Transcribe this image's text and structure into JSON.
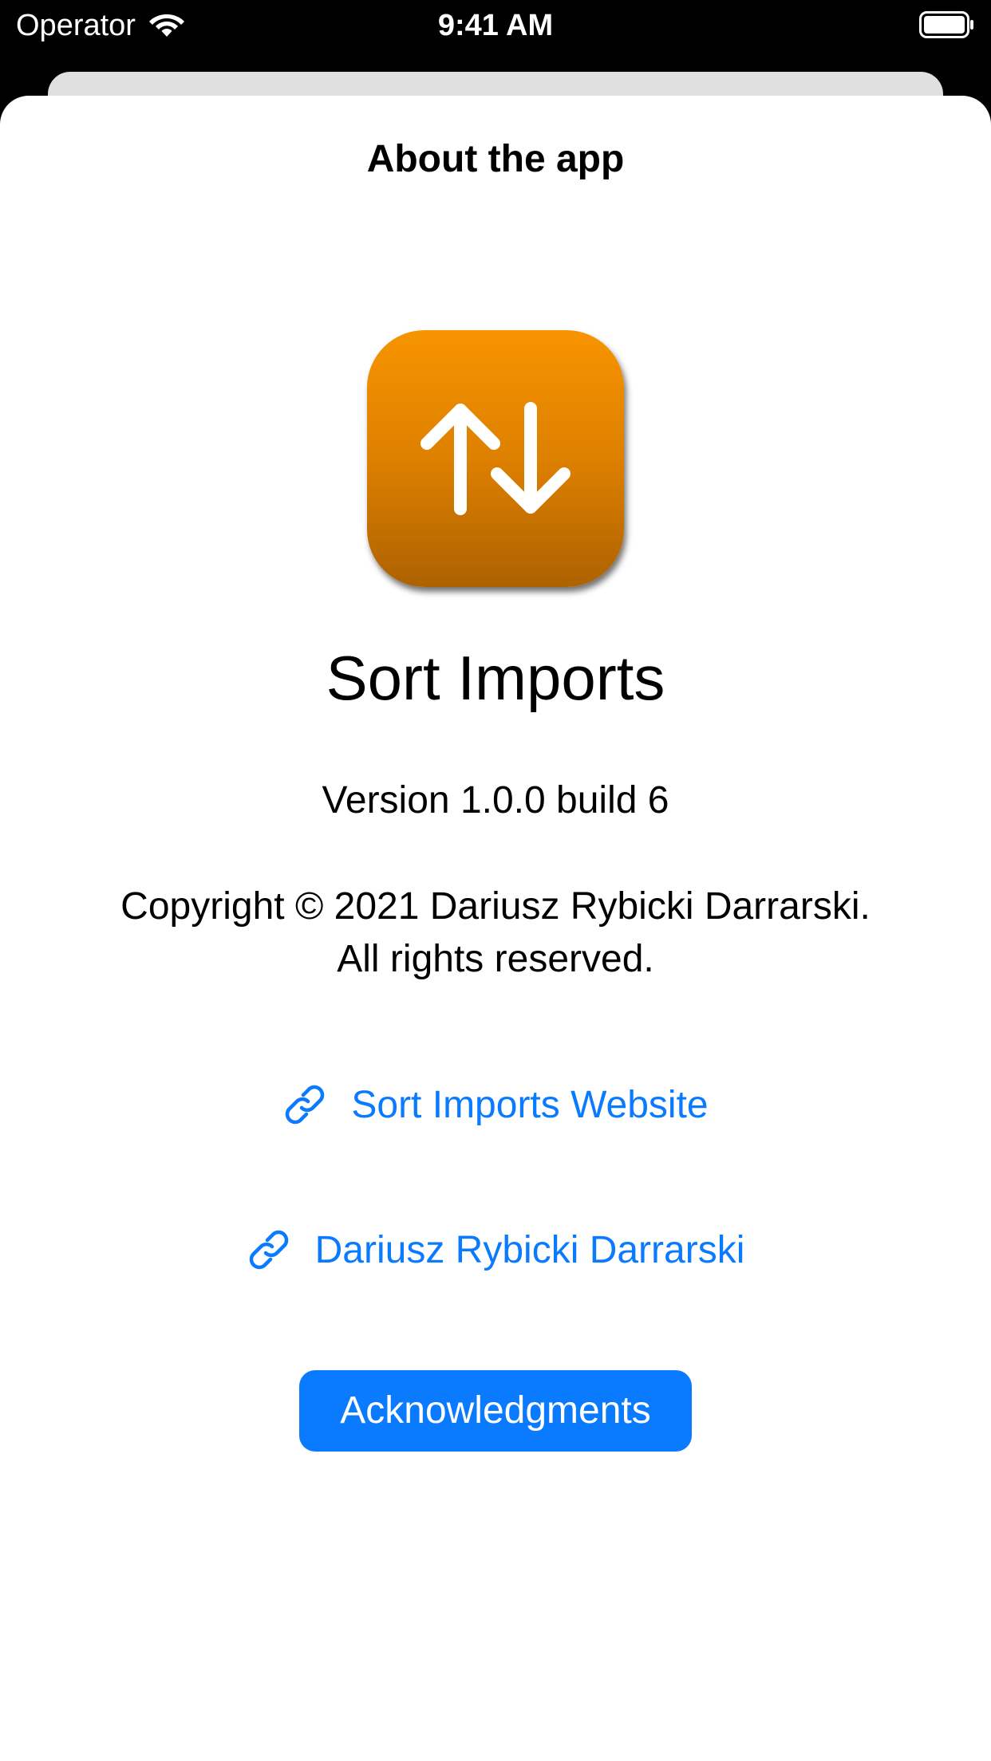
{
  "status_bar": {
    "carrier": "Operator",
    "time": "9:41 AM",
    "wifi_icon": "wifi-icon",
    "battery_icon": "battery-full-icon"
  },
  "sheet": {
    "title": "About the app",
    "app_icon": "sort-arrows-icon",
    "app_name": "Sort Imports",
    "version": "Version 1.0.0 build 6",
    "copyright_line1": "Copyright © 2021 Dariusz Rybicki Darrarski.",
    "copyright_line2": "All rights reserved.",
    "links": [
      {
        "label": "Sort Imports Website",
        "icon": "link-icon"
      },
      {
        "label": "Dariusz Rybicki Darrarski",
        "icon": "link-icon"
      }
    ],
    "acknowledgments_label": "Acknowledgments"
  },
  "colors": {
    "accent": "#0a7aff",
    "icon_gradient_top": "#f79400",
    "icon_gradient_bottom": "#ad6201",
    "status_bar_bg": "#000000",
    "sheet_bg": "#ffffff"
  }
}
